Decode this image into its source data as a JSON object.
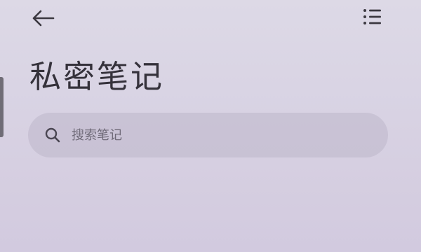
{
  "header": {
    "back_icon": "arrow-left-icon",
    "menu_icon": "list-menu-icon",
    "title": "私密笔记"
  },
  "search": {
    "icon": "search-icon",
    "placeholder": "搜索笔记",
    "value": ""
  },
  "colors": {
    "background": "#d9d4e4",
    "title_text": "#35323b",
    "search_bg": "#c7c0d3",
    "icon": "#3b3840"
  }
}
